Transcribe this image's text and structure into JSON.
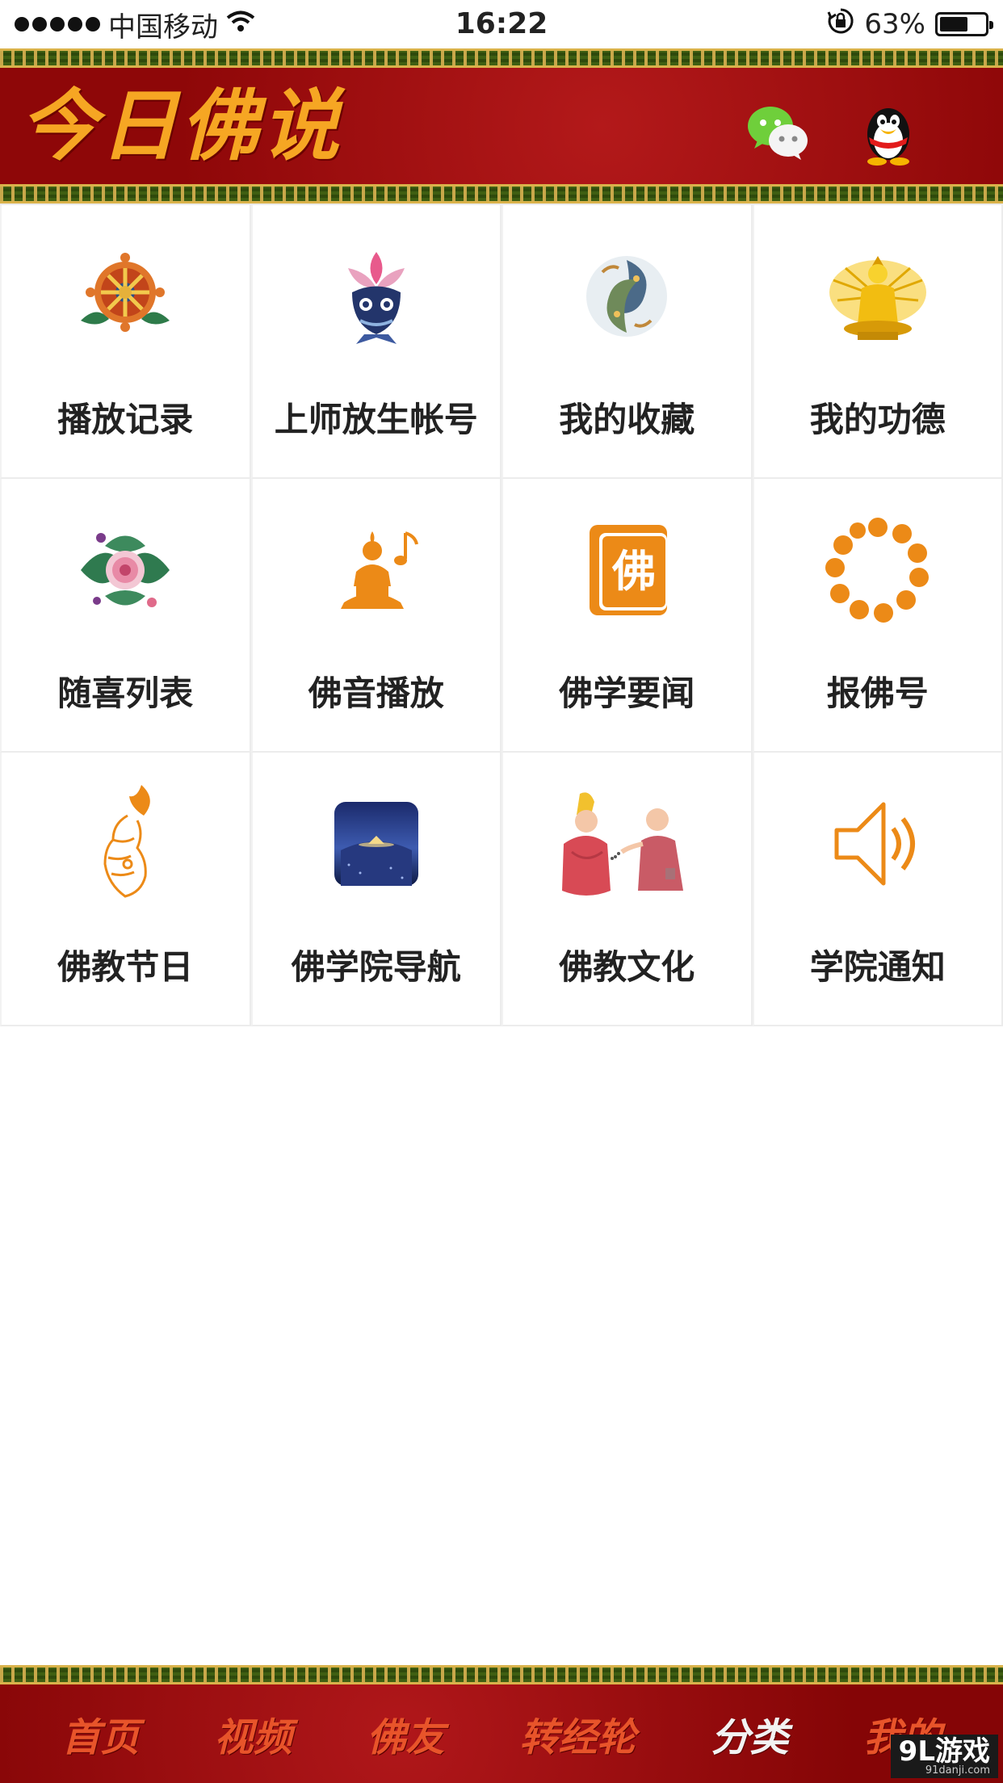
{
  "status_bar": {
    "carrier": "中国移动",
    "time": "16:22",
    "battery_percent": "63%",
    "battery_level": 0.63
  },
  "header": {
    "title": "今日佛说",
    "icons": [
      "wechat-icon",
      "qq-icon"
    ]
  },
  "grid": {
    "items": [
      {
        "label": "播放记录",
        "icon": "dharma-wheel-icon"
      },
      {
        "label": "上师放生帐号",
        "icon": "lotus-fish-icon"
      },
      {
        "label": "我的收藏",
        "icon": "double-fish-icon"
      },
      {
        "label": "我的功德",
        "icon": "golden-avalokiteshvara-icon"
      },
      {
        "label": "随喜列表",
        "icon": "peony-flower-icon"
      },
      {
        "label": "佛音播放",
        "icon": "buddha-music-icon"
      },
      {
        "label": "佛学要闻",
        "icon": "buddha-book-icon"
      },
      {
        "label": "报佛号",
        "icon": "prayer-beads-icon"
      },
      {
        "label": "佛教节日",
        "icon": "hand-flame-icon"
      },
      {
        "label": "佛学院导航",
        "icon": "night-mountain-icon"
      },
      {
        "label": "佛教文化",
        "icon": "monks-illustration-icon"
      },
      {
        "label": "学院通知",
        "icon": "speaker-icon"
      }
    ]
  },
  "bottom_nav": {
    "items": [
      "首页",
      "视频",
      "佛友",
      "转经轮",
      "分类",
      "我的"
    ],
    "active": "分类"
  },
  "watermark": {
    "brand": "9L游戏",
    "site": "91danji.com"
  },
  "colors": {
    "banner_red": "#9c0b0c",
    "fret_green": "#3f5f12",
    "gold": "#f6a623",
    "icon_orange": "#ec8a17"
  }
}
